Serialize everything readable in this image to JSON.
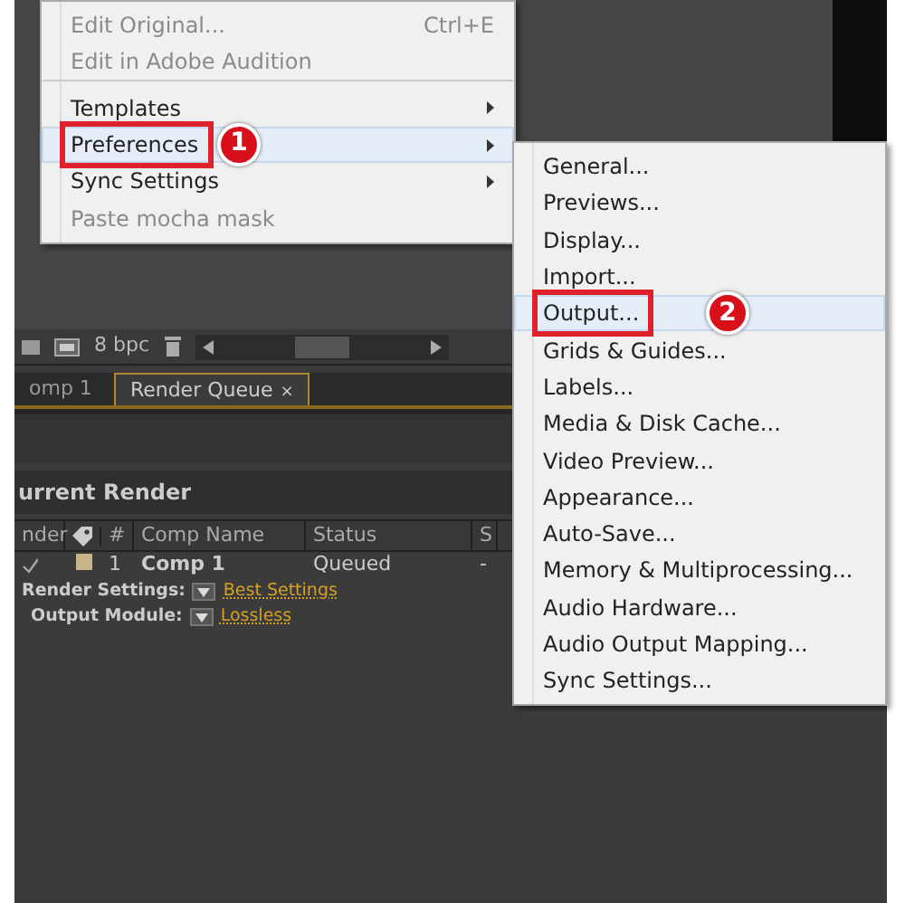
{
  "panel_toolbar": {
    "bit_depth": "8 bpc"
  },
  "tabs": [
    {
      "label": "omp 1",
      "selected": false,
      "closable": false
    },
    {
      "label": "Render Queue",
      "selected": true,
      "closable": true,
      "close": "×"
    }
  ],
  "section_title": "urrent Render",
  "columns": [
    "nder",
    "#",
    "Comp Name",
    "Status",
    "S"
  ],
  "rows": [
    {
      "checked": true,
      "color": "#c8b48a",
      "number": "1",
      "comp_name": "Comp 1",
      "status": "Queued",
      "column_5": "-",
      "settings": [
        {
          "label": "Render Settings:",
          "value": "Best Settings"
        },
        {
          "label": "Output Module:",
          "value": "Lossless"
        }
      ]
    }
  ],
  "menu": {
    "items": [
      {
        "label": "Edit Original...",
        "shortcut": "Ctrl+E",
        "disabled": true,
        "submenu": false,
        "selected": false
      },
      {
        "label": "Edit in Adobe Audition",
        "disabled": true,
        "submenu": false,
        "selected": false,
        "separator_after": true
      },
      {
        "label": "Templates",
        "disabled": false,
        "submenu": true,
        "selected": false
      },
      {
        "label": "Preferences",
        "disabled": false,
        "submenu": true,
        "selected": true,
        "callout": "1"
      },
      {
        "label": "Sync Settings",
        "disabled": false,
        "submenu": true,
        "selected": false
      },
      {
        "label": "Paste mocha mask",
        "disabled": true,
        "submenu": false,
        "selected": false
      }
    ]
  },
  "submenu": {
    "items": [
      {
        "label": "General...",
        "selected": false
      },
      {
        "label": "Previews...",
        "selected": false
      },
      {
        "label": "Display...",
        "selected": false
      },
      {
        "label": "Import...",
        "selected": false
      },
      {
        "label": "Output...",
        "selected": true,
        "callout": "2"
      },
      {
        "label": "Grids & Guides...",
        "selected": false
      },
      {
        "label": "Labels...",
        "selected": false
      },
      {
        "label": "Media & Disk Cache...",
        "selected": false
      },
      {
        "label": "Video Preview...",
        "selected": false
      },
      {
        "label": "Appearance...",
        "selected": false
      },
      {
        "label": "Auto-Save...",
        "selected": false
      },
      {
        "label": "Memory & Multiprocessing...",
        "selected": false
      },
      {
        "label": "Audio Hardware...",
        "selected": false
      },
      {
        "label": "Audio Output Mapping...",
        "selected": false
      },
      {
        "label": "Sync Settings...",
        "selected": false
      }
    ]
  }
}
